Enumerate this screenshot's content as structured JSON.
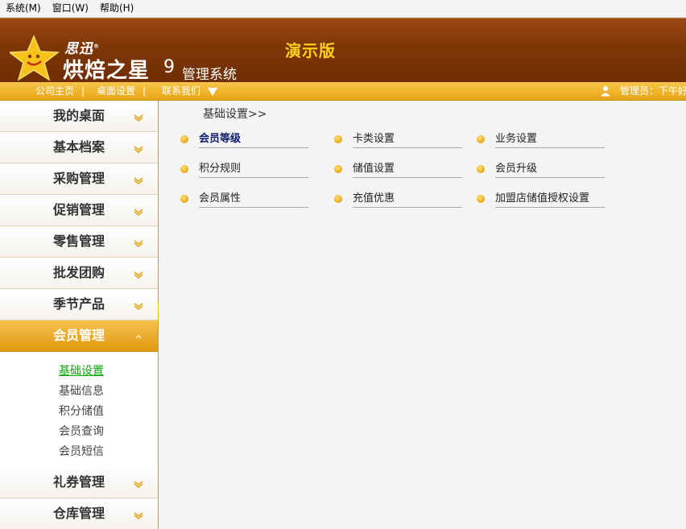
{
  "menubar": {
    "items": [
      "系统(M)",
      "窗口(W)",
      "帮助(H)"
    ]
  },
  "header": {
    "brand_small": "思迅",
    "brand_main": "烘焙之星",
    "version": "9",
    "system_name": "管理系统",
    "demo_label": "演示版"
  },
  "nav": {
    "home": "公司主页",
    "desktop_settings": "桌面设置",
    "contact": "联系我们",
    "separator": "|",
    "user_info": "管理员：下午好"
  },
  "sidebar": {
    "items": [
      {
        "label": "我的桌面"
      },
      {
        "label": "基本档案"
      },
      {
        "label": "采购管理"
      },
      {
        "label": "促销管理"
      },
      {
        "label": "零售管理"
      },
      {
        "label": "批发团购"
      },
      {
        "label": "季节产品"
      },
      {
        "label": "会员管理"
      },
      {
        "label": "礼券管理"
      },
      {
        "label": "仓库管理"
      }
    ],
    "sub_items": [
      "基础设置",
      "基础信息",
      "积分储值",
      "会员查询",
      "会员短信"
    ]
  },
  "content": {
    "breadcrumb": "基础设置>>",
    "options": [
      {
        "label": "会员等级"
      },
      {
        "label": "卡类设置"
      },
      {
        "label": "业务设置"
      },
      {
        "label": "积分规则"
      },
      {
        "label": "储值设置"
      },
      {
        "label": "会员升级"
      },
      {
        "label": "会员属性"
      },
      {
        "label": "充值优惠"
      },
      {
        "label": "加盟店储值授权设置"
      }
    ]
  },
  "colors": {
    "banner": "#7d3606",
    "accent_gold": "#e8a514",
    "demo_text": "#ffd11c",
    "current_link": "#0aa60a"
  }
}
